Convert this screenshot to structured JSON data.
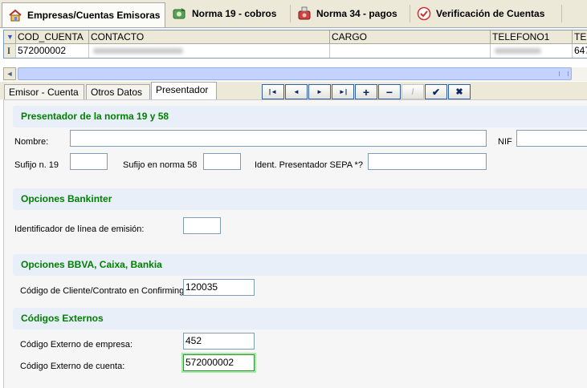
{
  "top_tabs": [
    {
      "label": "Empresas/Cuentas Emisoras",
      "icon": "house-icon"
    },
    {
      "label": "Norma 19 - cobros",
      "icon": "money-icon"
    },
    {
      "label": "Norma 34 - pagos",
      "icon": "payment-icon"
    },
    {
      "label": "Verificación de Cuentas",
      "icon": "check-circle-icon"
    }
  ],
  "grid": {
    "columns": [
      "COD_CUENTA",
      "CONTACTO",
      "CARGO",
      "TELEFONO1",
      "TEL"
    ],
    "row": {
      "indicator": "I",
      "cod_cuenta": "572000002",
      "contacto": "",
      "cargo": "",
      "telefono1": "",
      "tel": "647"
    }
  },
  "sub_tabs": [
    "Emisor - Cuenta",
    "Otros Datos",
    "Presentador"
  ],
  "nav_buttons": [
    {
      "glyph": "|◄",
      "name": "first-record-button"
    },
    {
      "glyph": "◄",
      "name": "prior-record-button"
    },
    {
      "glyph": "►",
      "name": "next-record-button"
    },
    {
      "glyph": "►|",
      "name": "last-record-button"
    },
    {
      "glyph": "+",
      "name": "insert-record-button"
    },
    {
      "glyph": "−",
      "name": "delete-record-button"
    },
    {
      "glyph": "/",
      "name": "edit-record-button"
    },
    {
      "glyph": "✔",
      "name": "post-record-button"
    },
    {
      "glyph": "✖",
      "name": "cancel-record-button"
    }
  ],
  "sections": {
    "presentador": {
      "title": "Presentador de la norma 19 y 58",
      "nombre_label": "Nombre:",
      "nombre_value": "",
      "nif_label": "NIF",
      "nif_value": "",
      "sufijo19_label": "Sufijo n. 19",
      "sufijo19_value": "",
      "sufijo58_label": "Sufijo en norma 58",
      "sufijo58_value": "",
      "sepa_label": "Ident. Presentador SEPA *?",
      "sepa_value": ""
    },
    "bankinter": {
      "title": "Opciones Bankinter",
      "linea_label": "Identificador de línea de emisión:",
      "linea_value": ""
    },
    "bbva": {
      "title": "Opciones BBVA, Caixa, Bankia",
      "confirming_label": "Código de Cliente/Contrato en Confirming:",
      "confirming_value": "120035"
    },
    "externos": {
      "title": "Códigos Externos",
      "empresa_label": "Código Externo de empresa:",
      "empresa_value": "452",
      "cuenta_label": "Código Externo de cuenta:",
      "cuenta_value": "572000002"
    }
  }
}
